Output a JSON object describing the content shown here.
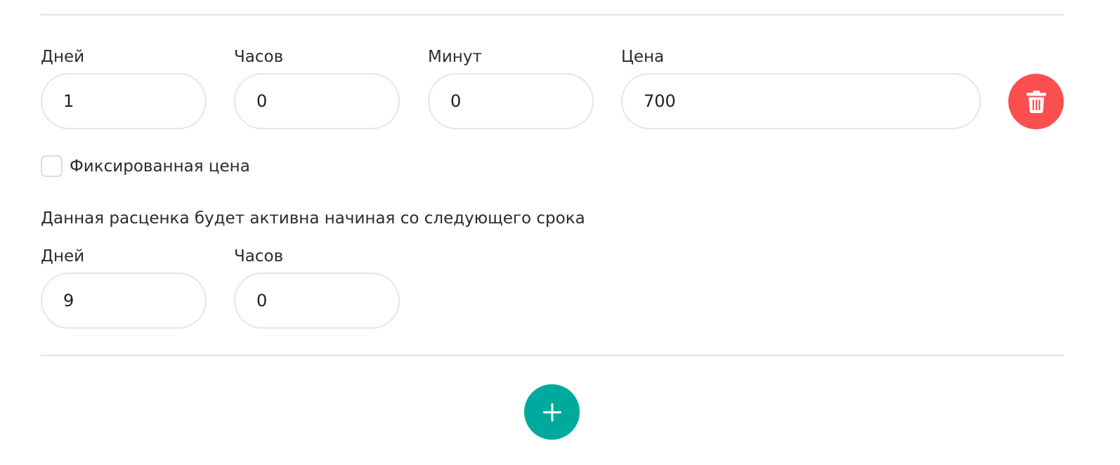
{
  "pricing": {
    "duration": {
      "days_label": "Дней",
      "days_value": "1",
      "hours_label": "Часов",
      "hours_value": "0",
      "minutes_label": "Минут",
      "minutes_value": "0",
      "price_label": "Цена",
      "price_value": "700"
    },
    "fixed_price_label": "Фиксированная цена",
    "fixed_price_checked": false,
    "activation": {
      "description": "Данная расценка будет активна начиная со следующего срока",
      "days_label": "Дней",
      "days_value": "9",
      "hours_label": "Часов",
      "hours_value": "0"
    }
  },
  "icons": {
    "delete": "trash-icon",
    "add": "plus-icon"
  },
  "colors": {
    "delete_button": "#fb4f4f",
    "add_button": "#00a99d",
    "divider": "#e4e4e4",
    "field_border": "#e6e6e6"
  }
}
